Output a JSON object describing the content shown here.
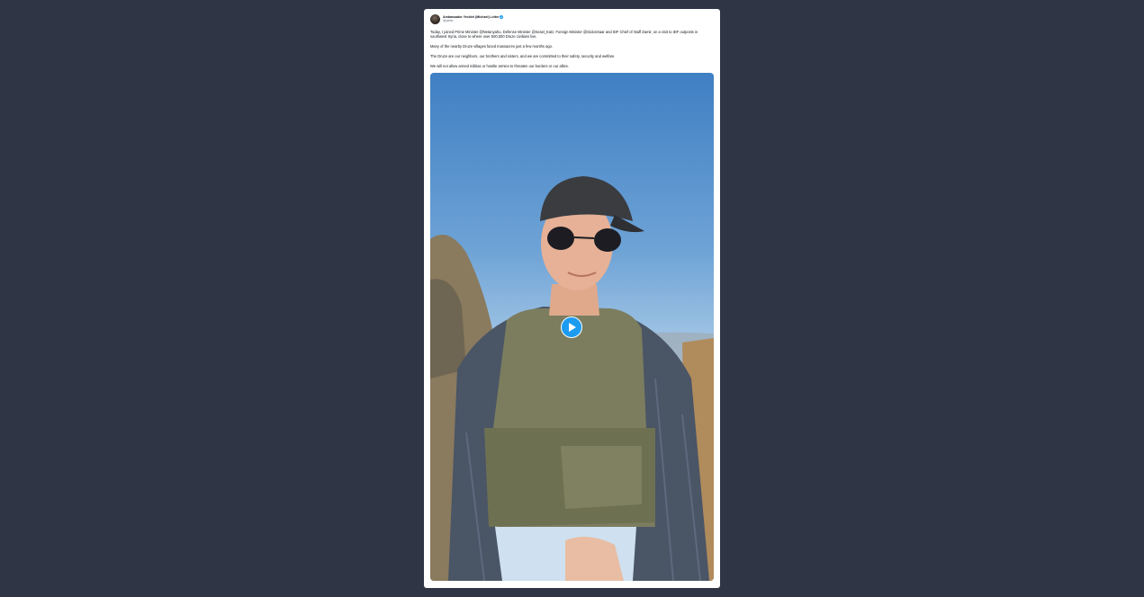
{
  "tweet": {
    "author": {
      "display_name": "Ambassador Yechiel (Michael) Leiter",
      "handle": "@yleiter",
      "avatar_icon": "profile-photo",
      "verified_icon": "verified-badge-icon",
      "verified_color": "#1d9bf0"
    },
    "paragraphs": [
      "Today, I joined Prime Minister @Netanyahu, Defense Minister @Israel_Katz, Foreign Minister @GidonSaar and IDF Chief of Staff Zamir, on a visit to IDF outposts in southwest Syria, close to where over 500,000 Druze civilians live.",
      "Many of the nearby Druze villages faced massacres just a few months ago.",
      "The Druze are our neighbors, our brothers and sisters, and we are committed to their safety, security and welfare.",
      "We will not allow armed militias or hostile armies to threaten our borders or our allies."
    ],
    "media": {
      "type": "video",
      "play_icon": "play-icon",
      "play_color": "#1d9bf0"
    }
  }
}
